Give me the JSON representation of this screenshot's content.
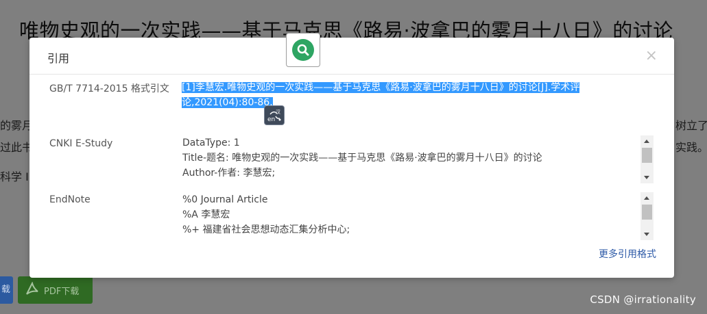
{
  "background": {
    "title": "唯物史观的一次实践——基于马克思《路易·波拿巴的雾月十八日》的讨论",
    "left_snippets": [
      "的雾月",
      "过此书",
      "科学 I"
    ],
    "right_snippets": [
      "树立了",
      "实践。"
    ],
    "buttons": {
      "download_label": "载",
      "pdf_label": "PDF下载"
    }
  },
  "modal": {
    "title": "引用",
    "close_symbol": "×",
    "rows": {
      "gbt": {
        "label": "GB/T 7714-2015 格式引文",
        "citation_line1": "[1]李慧宏.唯物史观的一次实践——基于马克思《路易·波拿巴的雾月十八日》的讨论[J].学术评",
        "citation_line2": "论,2021(04):80-86."
      },
      "cnki": {
        "label": "CNKI E-Study",
        "lines": [
          "DataType: 1",
          "Title-题名: 唯物史观的一次实践——基于马克思《路易·波拿巴的雾月十八日》的讨论",
          "Author-作者: 李慧宏;"
        ]
      },
      "endnote": {
        "label": "EndNote",
        "lines": [
          "%0 Journal Article",
          "%A 李慧宏",
          "%+ 福建省社会思想动态汇集分析中心;"
        ]
      }
    },
    "more_link": "更多引用格式"
  },
  "overlays": {
    "search_icon": "search-icon",
    "translate_icon": "translate-icon"
  },
  "watermark": "CSDN @irrationality",
  "colors": {
    "highlight": "#3399ff",
    "search_green": "#2ea563",
    "link_blue": "#2d5aa7",
    "pdf_green": "#2f6a23",
    "download_blue": "#2c5aa0"
  }
}
